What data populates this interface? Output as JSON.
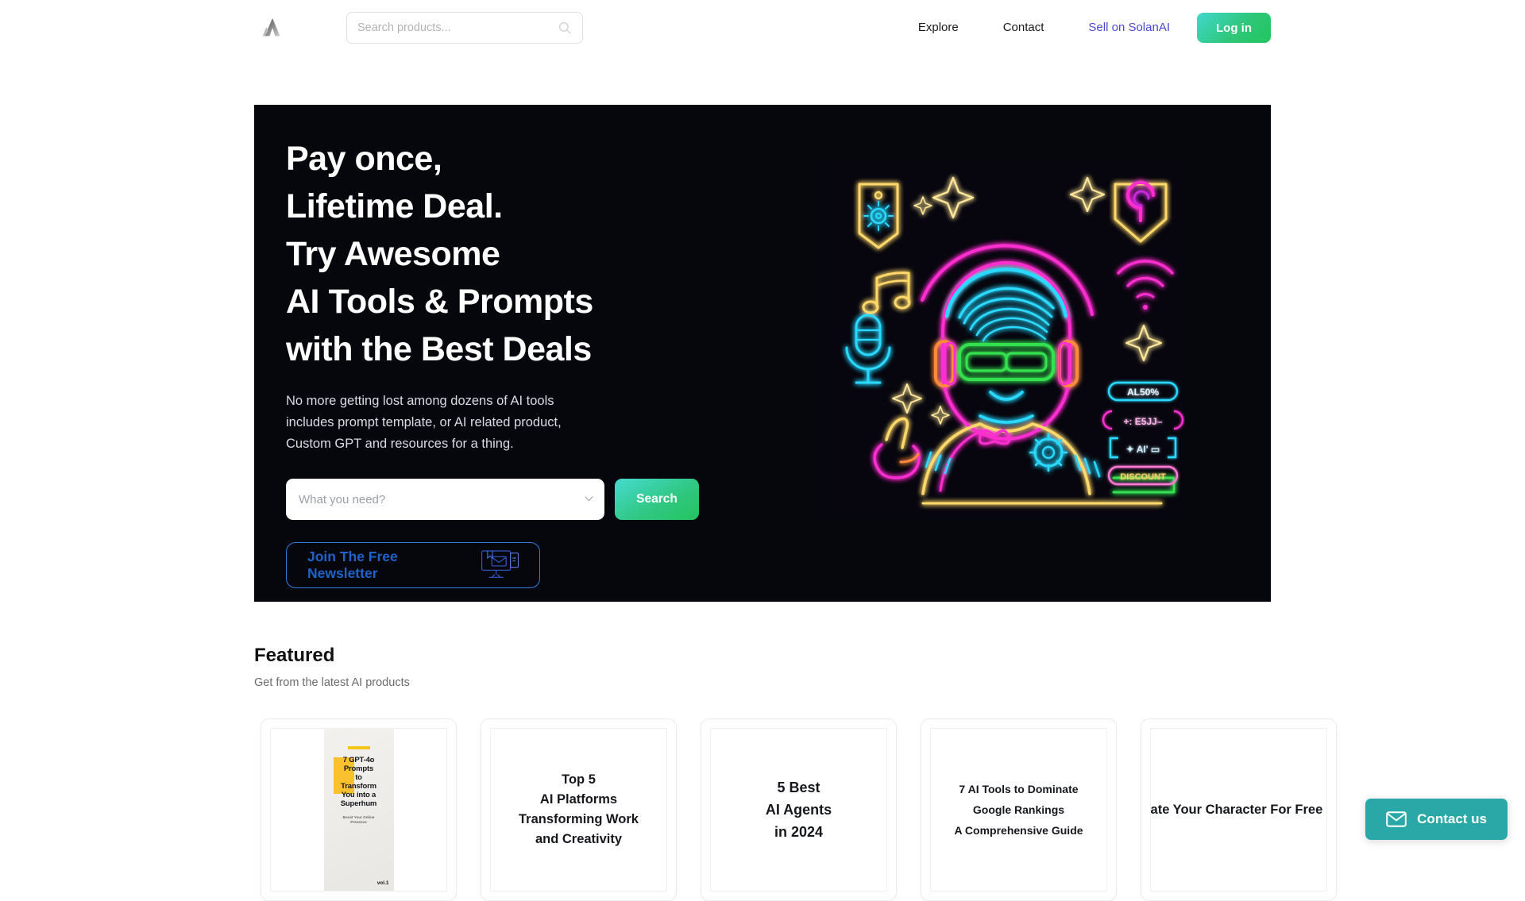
{
  "header": {
    "logo_alt": "SolanAI logo",
    "search": {
      "value": "",
      "placeholder": "Search products..."
    },
    "nav": [
      {
        "label": "Explore",
        "accent": false
      },
      {
        "label": "Contact",
        "accent": false
      },
      {
        "label": "Sell on SolanAI",
        "accent": true
      }
    ],
    "login_label": "Log in",
    "accent_color": "#4a4ad4",
    "login_gradient": [
      "#40d8cf",
      "#22c55e"
    ]
  },
  "hero": {
    "background": "#06060d",
    "title": "Pay once,\nLifetime Deal.\nTry Awesome\nAI Tools & Prompts\nwith the Best Deals",
    "subtitle": "No more getting lost among dozens of AI tools\nincludes prompt template, or AI related product,\nCustom GPT and resources for a thing.",
    "select": {
      "value": "",
      "placeholder": "What you need?"
    },
    "search_button": "Search",
    "newsletter_label": "Join The Free\nNewsletter",
    "newsletter_border_color": "#2d7fe0",
    "newsletter_text_color": "#1f62c9",
    "illustration": {
      "description": "neon character with VR goggles and headphones",
      "badges": [
        "AL50%",
        "(+: E5JJ-)",
        "[+ AI' =]",
        "DISCOUNT"
      ]
    }
  },
  "featured": {
    "title": "Featured",
    "subtitle": "Get from the latest AI products",
    "cards": [
      {
        "type": "cover",
        "title": "7 GPT-4o\nPrompts\nto\nTransform\nYou into a\nSuperhum",
        "subtitle": "Boost Your Online\nPresence",
        "volume": "vol.1"
      },
      {
        "type": "text",
        "title": "Top 5\nAI Platforms\nTransforming Work\nand Creativity",
        "font_size": "16.5px"
      },
      {
        "type": "text",
        "title": "5 Best\nAI Agents\nin 2024",
        "font_size": "18px"
      },
      {
        "type": "text",
        "title": "7 AI Tools to Dominate\nGoogle Rankings\nA Comprehensive Guide",
        "font_size": "14px"
      },
      {
        "type": "text",
        "title": "How to Animate\nYour Character\nFor Free\nwith AI Tools",
        "font_size": "16.5px"
      }
    ]
  },
  "contact_widget": {
    "label": "Contact us",
    "color": "#2aa8a8"
  }
}
